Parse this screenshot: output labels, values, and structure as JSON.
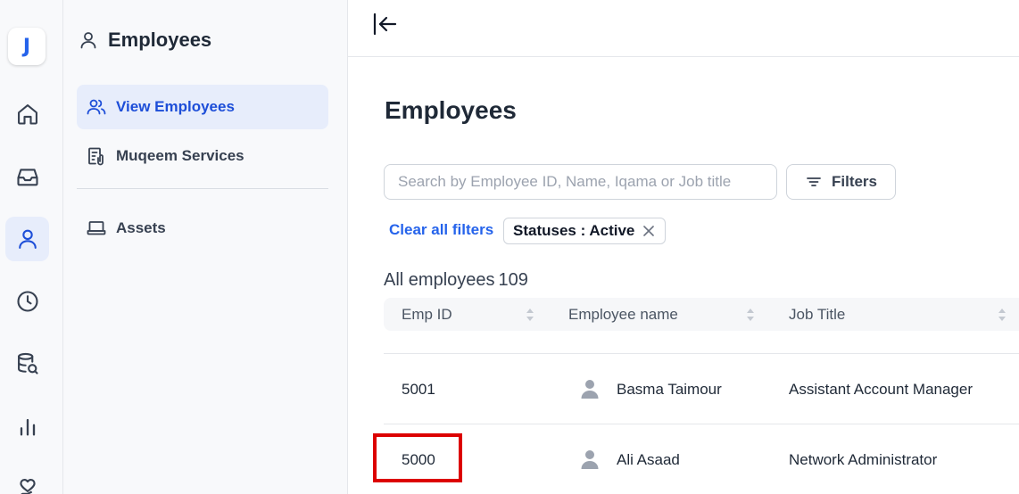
{
  "app": {
    "logo_letter": "J"
  },
  "rail": [
    {
      "icon": "home-icon"
    },
    {
      "icon": "inbox-icon"
    },
    {
      "icon": "user-icon",
      "active": true
    },
    {
      "icon": "clock-icon"
    },
    {
      "icon": "database-search-icon"
    },
    {
      "icon": "bar-chart-icon"
    },
    {
      "icon": "heart-hand-icon"
    }
  ],
  "sidebar": {
    "title": "Employees",
    "items": [
      {
        "label": "View Employees",
        "active": true
      },
      {
        "label": "Muqeem Services"
      },
      {
        "label": "Assets"
      }
    ]
  },
  "main": {
    "title": "Employees",
    "search_placeholder": "Search by Employee ID, Name, Iqama or Job title",
    "filters_label": "Filters",
    "clear_filters_label": "Clear all filters",
    "filter_chip": "Statuses : Active",
    "all_label": "All employees",
    "count": "109",
    "columns": [
      "Emp ID",
      "Employee name",
      "Job Title"
    ],
    "rows": [
      {
        "id": "5001",
        "name": "Basma Taimour",
        "title": "Assistant Account Manager"
      },
      {
        "id": "5000",
        "name": "Ali Asaad",
        "title": "Network Administrator"
      }
    ]
  },
  "colors": {
    "accent": "#2563eb",
    "highlight": "#dc0000"
  }
}
